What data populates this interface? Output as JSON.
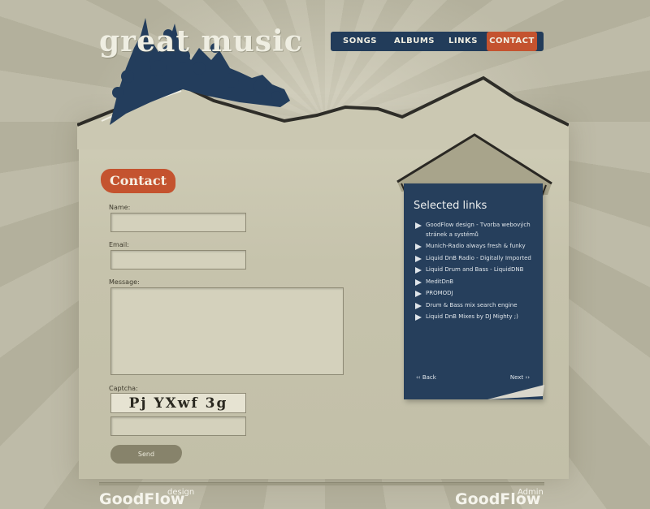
{
  "site": {
    "logo_text": "great music"
  },
  "nav": {
    "items": [
      {
        "label": "SONGS"
      },
      {
        "label": "ALBUMS"
      },
      {
        "label": "LINKS"
      },
      {
        "label": "CONTACT",
        "active": true
      }
    ]
  },
  "contact": {
    "heading": "Contact",
    "name_label": "Name:",
    "name_value": "",
    "email_label": "Email:",
    "email_value": "",
    "message_label": "Message:",
    "message_value": "",
    "captcha_label": "Captcha:",
    "captcha_text": "Pj YXwf 3g",
    "captcha_value": "",
    "send_label": "Send"
  },
  "links_panel": {
    "title": "Selected links",
    "items": [
      "GoodFlow design - Tvorba webových stránek a systémů",
      "Munich-Radio always fresh & funky",
      "Liquid DnB Radio - Digitally Imported",
      "Liquid Drum and Bass - LiquidDNB",
      "MeditDnB",
      "PROMODJ",
      "Drum & Bass mix search engine",
      "Liquid DnB Mixes by DJ Mighty ;)"
    ],
    "prev_label": "‹‹ Back",
    "next_label": "Next ››"
  },
  "footer": {
    "left_logo": "GoodFlow",
    "left_sub": "design",
    "right_logo": "GoodFlow",
    "right_sub": "Admin"
  },
  "colors": {
    "accent": "#c4532f",
    "navy": "#223c5a",
    "paper": "#c6c3ac",
    "background": "#b9b6a1"
  },
  "icons": [
    "arrow-right-icon",
    "tree-silhouette-icon",
    "mountain-ridge-icon"
  ]
}
